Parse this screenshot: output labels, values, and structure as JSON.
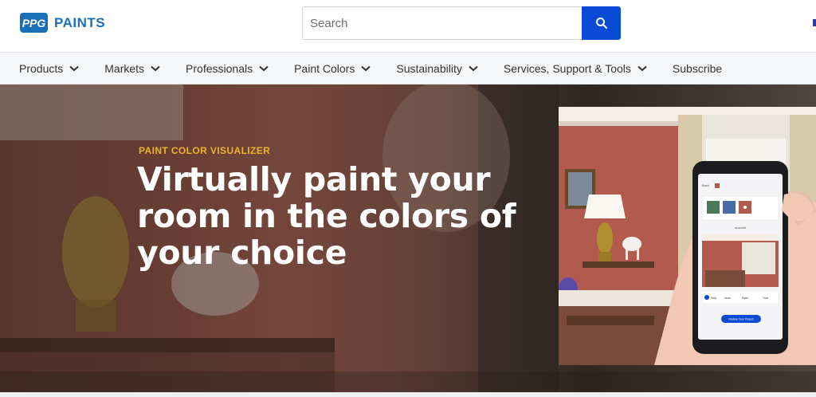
{
  "brand": {
    "logo_badge_text": "PPG",
    "name": "PAINTS",
    "color": "#1a6fb8"
  },
  "search": {
    "placeholder": "Search",
    "value": "",
    "button_icon": "search-icon",
    "button_color": "#0a4bd6"
  },
  "nav": {
    "items": [
      {
        "label": "Products",
        "icon": "chevron-down-icon"
      },
      {
        "label": "Markets",
        "icon": "chevron-down-icon"
      },
      {
        "label": "Professionals",
        "icon": "chevron-down-icon"
      },
      {
        "label": "Paint Colors",
        "icon": "chevron-down-icon"
      },
      {
        "label": "Sustainability",
        "icon": "chevron-down-icon"
      },
      {
        "label": "Services, Support & Tools",
        "icon": "chevron-down-icon"
      },
      {
        "label": "Subscribe",
        "icon": ""
      }
    ]
  },
  "hero": {
    "eyebrow": "PAINT COLOR VISUALIZER",
    "eyebrow_color": "#f0b32c",
    "title_lines": [
      "Virtually paint your",
      "room in the colors of",
      "your choice"
    ],
    "phone_screen": {
      "back_label": "Back",
      "swatch_caption": "scandal",
      "actions": [
        "Help",
        "Undo",
        "Paint",
        "Tone"
      ],
      "review_button": "Review Your Project"
    }
  }
}
